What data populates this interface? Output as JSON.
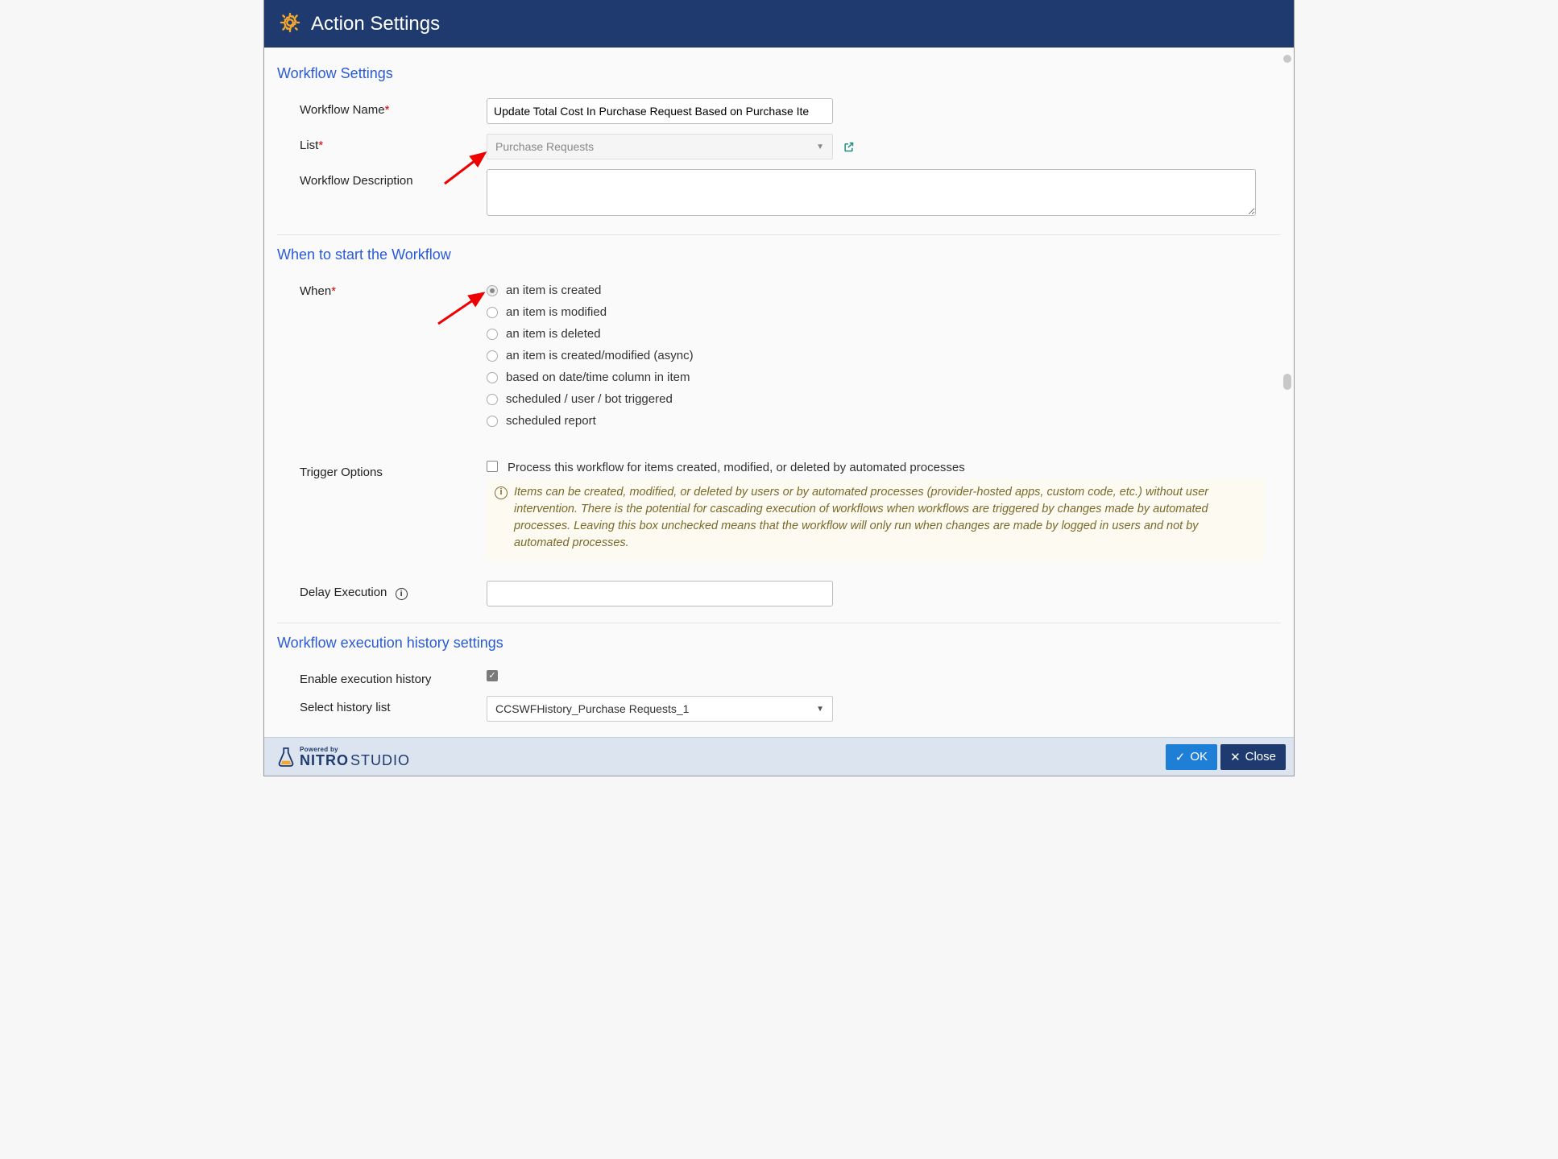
{
  "header": {
    "title": "Action Settings"
  },
  "sections": {
    "workflow_settings": "Workflow Settings",
    "when_start": "When to start the Workflow",
    "history": "Workflow execution history settings"
  },
  "labels": {
    "workflow_name": "Workflow Name",
    "list": "List",
    "workflow_description": "Workflow Description",
    "when": "When",
    "trigger_options": "Trigger Options",
    "delay_execution": "Delay Execution",
    "enable_history": "Enable execution history",
    "select_history_list": "Select history list"
  },
  "fields": {
    "workflow_name_value": "Update Total Cost In Purchase Request Based on Purchase Ite",
    "list_value": "Purchase Requests",
    "workflow_description_value": "",
    "delay_execution_value": "",
    "history_list_value": "CCSWFHistory_Purchase Requests_1",
    "enable_history_checked": true
  },
  "when_options": [
    {
      "label": "an item is created",
      "selected": true
    },
    {
      "label": "an item is modified",
      "selected": false
    },
    {
      "label": "an item is deleted",
      "selected": false
    },
    {
      "label": "an item is created/modified (async)",
      "selected": false
    },
    {
      "label": "based on date/time column in item",
      "selected": false
    },
    {
      "label": "scheduled / user / bot triggered",
      "selected": false
    },
    {
      "label": "scheduled report",
      "selected": false
    }
  ],
  "trigger": {
    "checkbox_label": "Process this workflow for items created, modified, or deleted by automated processes",
    "checked": false,
    "info_text": "Items can be created, modified, or deleted by users or by automated processes (provider-hosted apps, custom code, etc.) without user intervention. There is the potential for cascading execution of workflows when workflows are triggered by changes made by automated processes. Leaving this box unchecked means that the workflow will only run when changes are made by logged in users and not by automated processes."
  },
  "footer": {
    "powered_by": "Powered by",
    "brand_nitro": "NITRO",
    "brand_studio": " STUDIO",
    "ok": "OK",
    "close": "Close"
  }
}
